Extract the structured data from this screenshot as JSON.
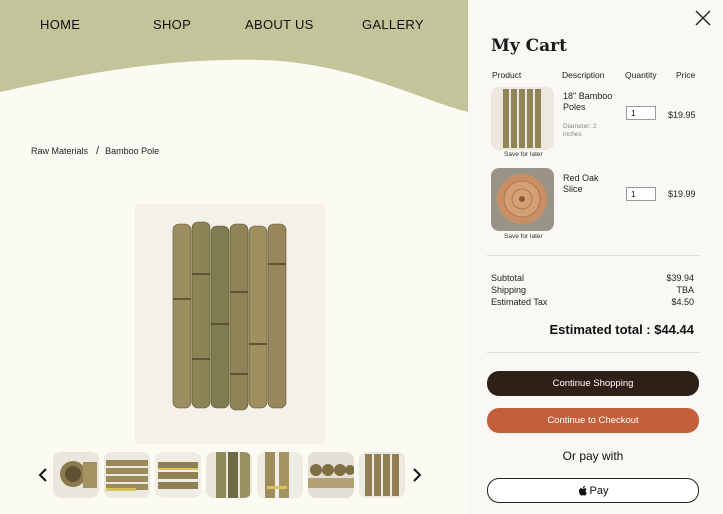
{
  "nav": {
    "items": [
      "HOME",
      "SHOP",
      "ABOUT US",
      "GALLERY"
    ]
  },
  "breadcrumb": {
    "items": [
      "Raw Materials",
      "Bamboo Pole"
    ],
    "separator": "/"
  },
  "gallery": {
    "thumbnail_count": 7
  },
  "cart": {
    "title": "My Cart",
    "columns": [
      "Product",
      "Description",
      "Quantity",
      "Price"
    ],
    "items": [
      {
        "name": "18\" Bamboo Poles",
        "meta": "Diameter: 2 inches",
        "quantity": "1",
        "price": "$19.95",
        "save_label": "Save for later"
      },
      {
        "name": "Red Oak Slice",
        "meta": "",
        "quantity": "1",
        "price": "$19.99",
        "save_label": "Save for later"
      }
    ],
    "summary": {
      "subtotal_label": "Subtotal",
      "subtotal": "$39.94",
      "shipping_label": "Shipping",
      "shipping": "TBA",
      "tax_label": "Estimated Tax",
      "tax": "$4.50"
    },
    "total": "Estimated total : $44.44",
    "continue_shopping": "Continue Shopping",
    "checkout": "Continue to Checkout",
    "or_pay": "Or pay with",
    "apple_pay": "Pay"
  },
  "colors": {
    "wave": "#c2c49a",
    "page_bg": "#fbfaf3",
    "cart_bg": "#faf8f5",
    "dark_button": "#2e1f17",
    "checkout_button": "#c45f3c"
  }
}
